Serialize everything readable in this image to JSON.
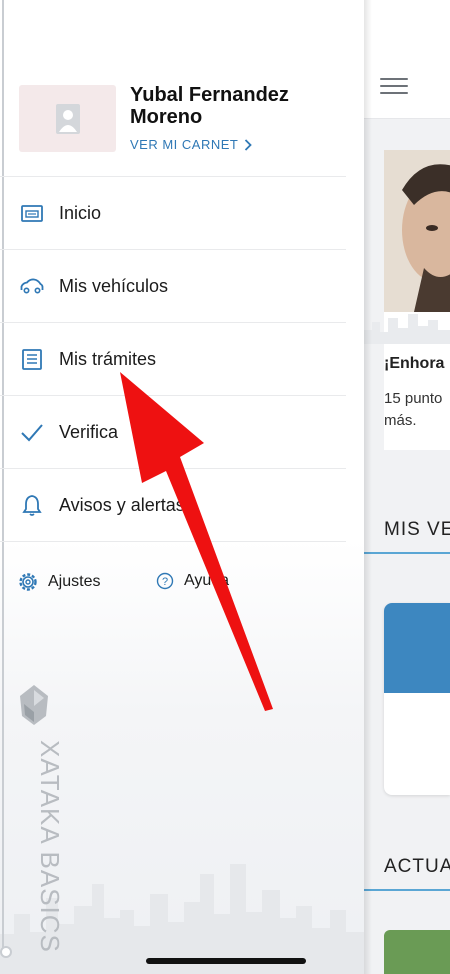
{
  "profile": {
    "name": "Yubal Fernandez Moreno",
    "card_link": "VER MI CARNET"
  },
  "menu": {
    "items": [
      {
        "label": "Inicio",
        "icon": "home-card-icon"
      },
      {
        "label": "Mis vehículos",
        "icon": "car-icon"
      },
      {
        "label": "Mis trámites",
        "icon": "document-list-icon"
      },
      {
        "label": "Verifica",
        "icon": "checkmark-icon"
      },
      {
        "label": "Avisos y alertas",
        "icon": "bell-icon"
      }
    ]
  },
  "footer": {
    "settings_label": "Ajustes",
    "help_label": "Ayuda"
  },
  "watermark": {
    "text": "XATAKA BASICS"
  },
  "main": {
    "card_title": "¡Enhora",
    "card_text_line1": "15 punto",
    "card_text_line2": "más.",
    "section1_title": "MIS VE",
    "section2_title": "ACTUA"
  },
  "colors": {
    "accent": "#2f78b5",
    "section_rule": "#5aa6d4",
    "vehicle_band": "#3d87c0",
    "annotation_arrow": "#ee1111"
  }
}
